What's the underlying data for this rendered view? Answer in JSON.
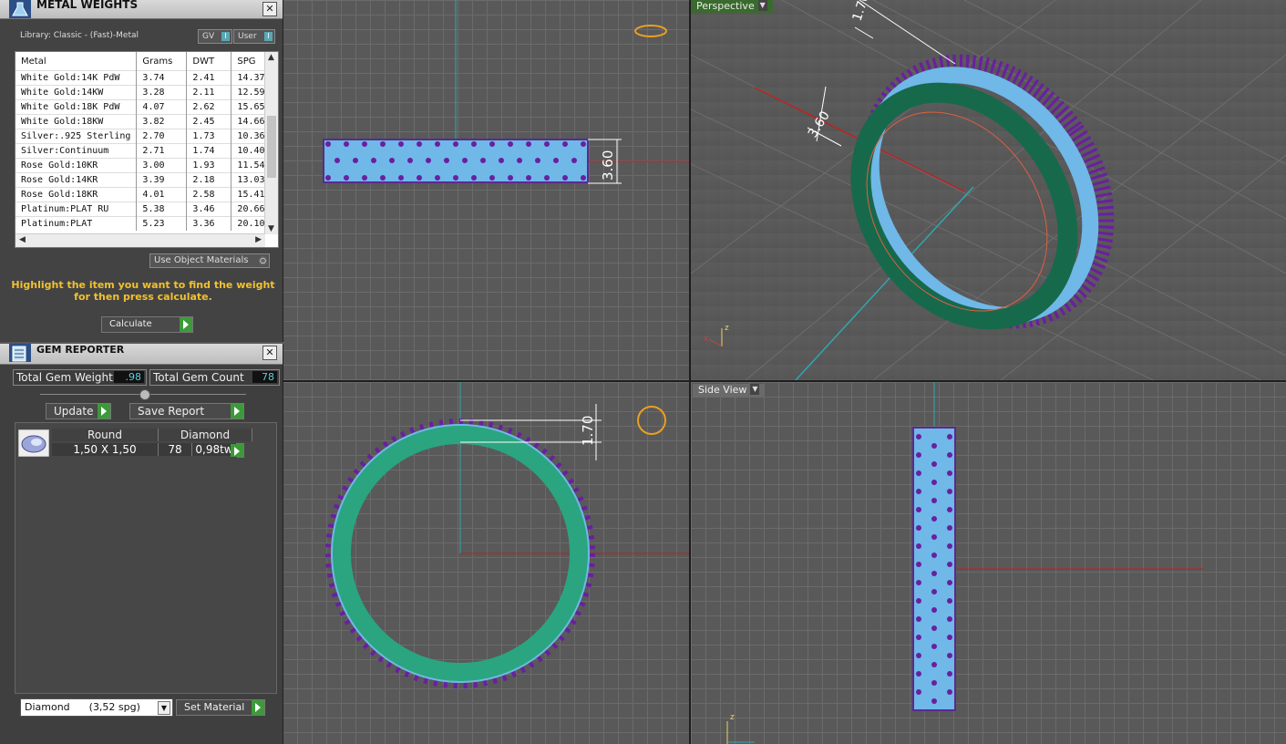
{
  "viewports": {
    "top_right_label": "Perspective",
    "bottom_right_label": "Side View",
    "dims": {
      "front_width": "3.60",
      "perspective_top": "1.70",
      "perspective_side": "3.60",
      "top_view_thickness": "1.70"
    },
    "axis": {
      "x": "x",
      "z": "z"
    }
  },
  "metal_weights": {
    "title": "METAL WEIGHTS",
    "library": "Library: Classic - (Fast)-Metal",
    "gv_label": "GV",
    "user_label": "User",
    "columns": [
      "Metal",
      "Grams",
      "DWT",
      "SPG"
    ],
    "rows": [
      [
        "White Gold:14K PdW",
        "3.74",
        "2.41",
        "14.37"
      ],
      [
        "White Gold:14KW",
        "3.28",
        "2.11",
        "12.59"
      ],
      [
        "White Gold:18K PdW",
        "4.07",
        "2.62",
        "15.65"
      ],
      [
        "White Gold:18KW",
        "3.82",
        "2.45",
        "14.66"
      ],
      [
        "Silver:.925 Sterling",
        "2.70",
        "1.73",
        "10.36"
      ],
      [
        "Silver:Continuum",
        "2.71",
        "1.74",
        "10.40"
      ],
      [
        "Rose Gold:10KR",
        "3.00",
        "1.93",
        "11.54"
      ],
      [
        "Rose Gold:14KR",
        "3.39",
        "2.18",
        "13.03"
      ],
      [
        "Rose Gold:18KR",
        "4.01",
        "2.58",
        "15.41"
      ],
      [
        "Platinum:PLAT RU",
        "5.38",
        "3.46",
        "20.66"
      ],
      [
        "Platinum:PLAT",
        "5.23",
        "3.36",
        "20.10"
      ]
    ],
    "use_object_materials": "Use Object Materials",
    "hint": "Highlight the item you want to find the weight for then press calculate.",
    "calculate_label": "Calculate"
  },
  "gem_reporter": {
    "title": "GEM REPORTER",
    "total_weight_label": "Total Gem Weight",
    "total_weight_value": ".98",
    "total_count_label": "Total Gem Count",
    "total_count_value": "78",
    "update_label": "Update",
    "save_report_label": "Save Report",
    "headers": [
      "Round",
      "Diamond"
    ],
    "row": {
      "size": "1,50 X 1,50",
      "count": "78",
      "weight": "0,98tw"
    },
    "material_select": "Diamond      (3,52 spg)",
    "set_material_label": "Set Material"
  },
  "colors": {
    "band": "#1b7a5a",
    "stones": "#6fb8e8",
    "prongs": "#6a1fa0",
    "accent": "#3a6a2f"
  }
}
